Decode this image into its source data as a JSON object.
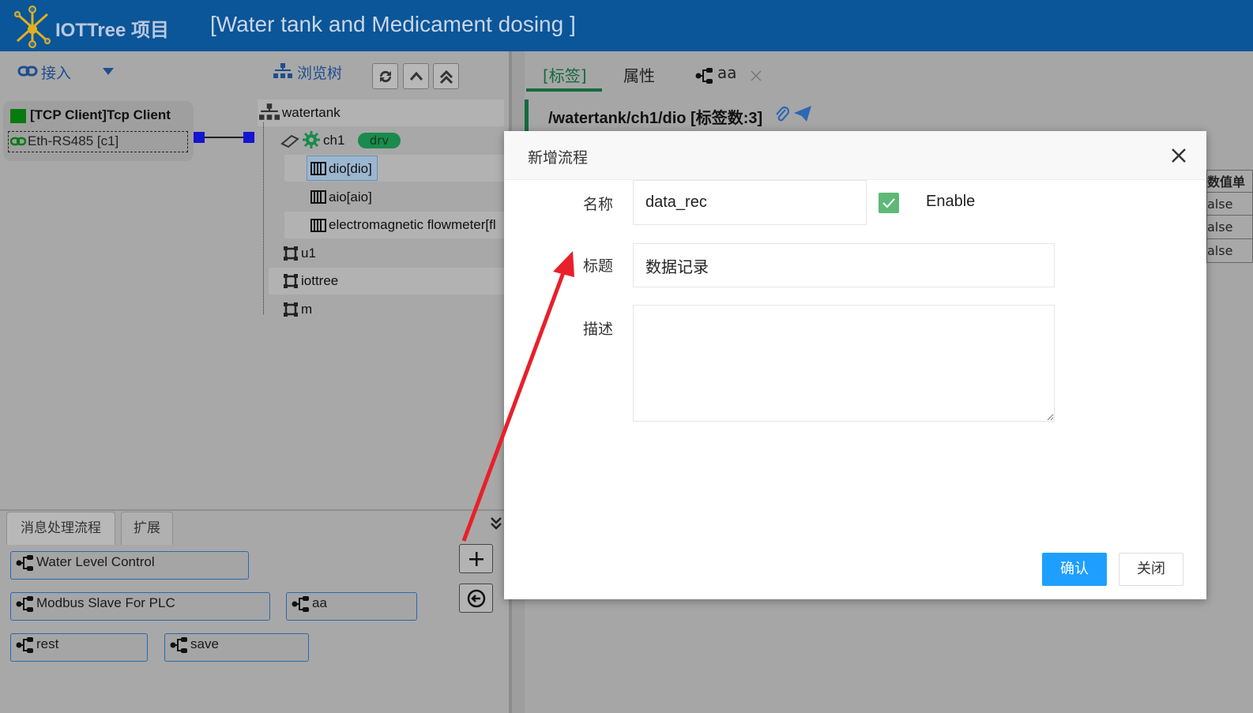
{
  "header": {
    "app_title": "IOTTree 项目",
    "project_title": "[Water tank and Medicament dosing ]"
  },
  "left_toolbar": {
    "access_label": "接入",
    "browse_tree_label": "浏览树"
  },
  "connector": {
    "title": "[TCP Client]Tcp Client",
    "sub": "Eth-RS485 [c1]"
  },
  "tree": {
    "root": "watertank",
    "channel": "ch1",
    "drv_badge": "drv",
    "devices": [
      "dio[dio]",
      "aio[aio]",
      "electromagnetic flowmeter[fl"
    ],
    "nodes": [
      "u1",
      "iottree",
      "m"
    ]
  },
  "bottom": {
    "tabs": [
      "消息处理流程",
      "扩展"
    ],
    "flows": [
      "Water Level Control",
      "Modbus Slave For PLC",
      "aa",
      "rest",
      "save"
    ]
  },
  "right": {
    "tabs": [
      "[标签]",
      "属性",
      "aa"
    ],
    "path": "/watertank/ch1/dio [标签数:3]",
    "table_header": "数值单",
    "table_cells": [
      "alse",
      "alse",
      "alse"
    ]
  },
  "dialog": {
    "title": "新增流程",
    "name_label": "名称",
    "name_value": "data_rec",
    "enable_label": "Enable",
    "title_label": "标题",
    "title_value": "数据记录",
    "desc_label": "描述",
    "desc_value": "",
    "confirm": "确认",
    "close": "关闭"
  },
  "colors": {
    "header_bg": "#0b5599",
    "primary_btn": "#1e9fff",
    "checkbox": "#5fb878",
    "annotation_arrow": "#e8202a"
  }
}
